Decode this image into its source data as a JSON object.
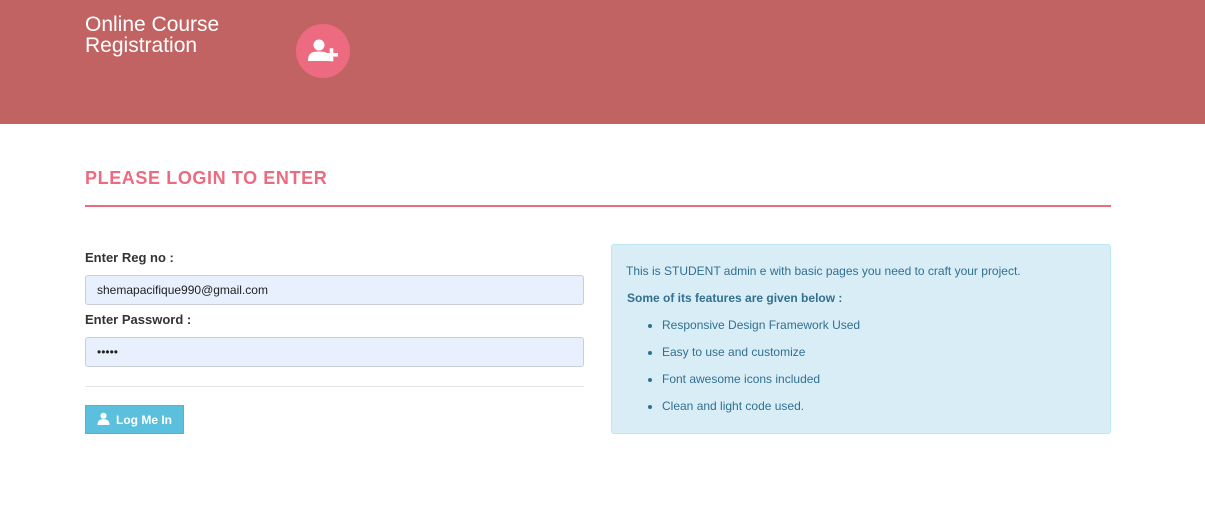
{
  "header": {
    "brand_line1": "Online Course",
    "brand_line2": "Registration",
    "brand_icon": "user-plus-icon",
    "background_color": "#c16363",
    "icon_circle_color": "#ec6b80"
  },
  "login": {
    "title": "PLEASE LOGIN TO ENTER",
    "regno_label": "Enter Reg no :",
    "regno_value": "shemapacifique990@gmail.com",
    "password_label": "Enter Password :",
    "password_value": "•••••",
    "button_label": "Log Me In",
    "button_icon": "user-icon",
    "accent_color": "#ec6b80",
    "button_color": "#5bc0de"
  },
  "info": {
    "intro": "This is STUDENT admin e with basic pages you need to craft your project.",
    "subtitle": "Some of its features are given below :",
    "features": [
      "Responsive Design Framework Used",
      "Easy to use and customize",
      "Font awesome icons included",
      "Clean and light code used."
    ],
    "background_color": "#d9edf7",
    "text_color": "#31708f"
  }
}
